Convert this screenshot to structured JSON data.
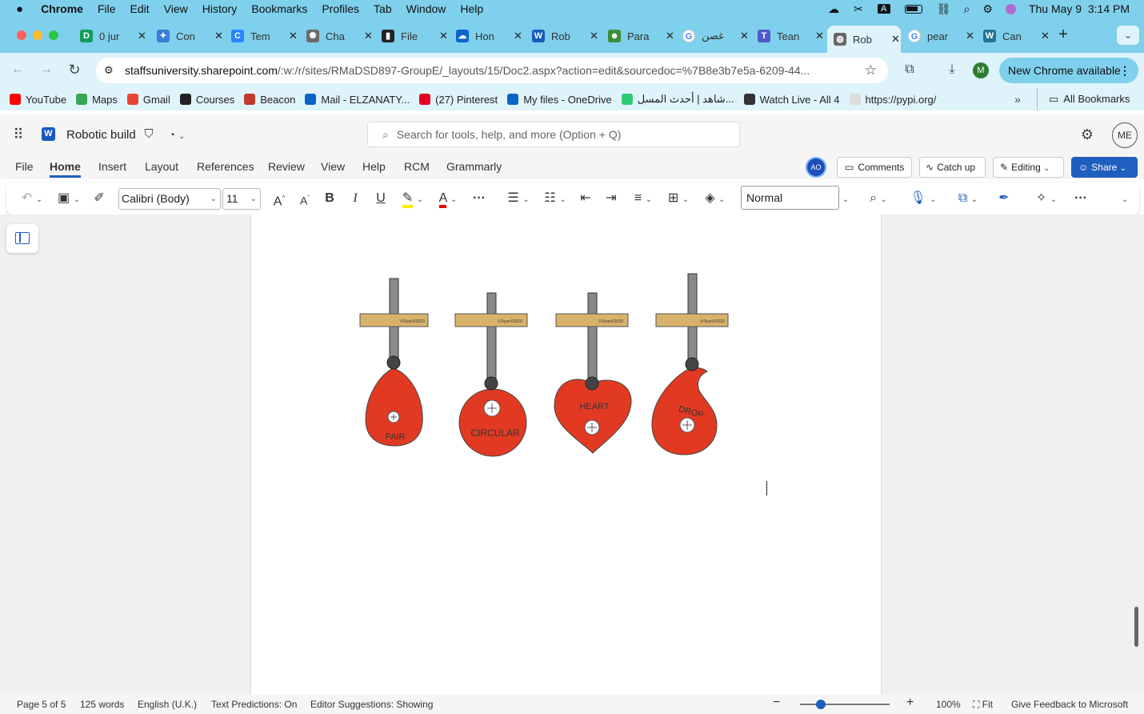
{
  "menubar": {
    "app": "Chrome",
    "items": [
      "File",
      "Edit",
      "View",
      "History",
      "Bookmarks",
      "Profiles",
      "Tab",
      "Window",
      "Help"
    ],
    "input_badge": "A",
    "clock": "Thu May 9  3:14 PM"
  },
  "tabs": [
    {
      "title": "0 jur",
      "color": "#0f9d58",
      "glyph": "D"
    },
    {
      "title": "Con",
      "color": "#3a7bd5",
      "glyph": "✦"
    },
    {
      "title": "Tem",
      "color": "#2684ff",
      "glyph": "C"
    },
    {
      "title": "Cha",
      "color": "#6b6b6b",
      "glyph": "✺"
    },
    {
      "title": "File",
      "color": "#222222",
      "glyph": "▮"
    },
    {
      "title": "Hon",
      "color": "#0a64c8",
      "glyph": "☁"
    },
    {
      "title": "Rob",
      "color": "#185abd",
      "glyph": "W"
    },
    {
      "title": "Para",
      "color": "#3c8c3c",
      "glyph": "☻"
    },
    {
      "title": "غصن",
      "color": "#ffffff",
      "glyph": "G"
    },
    {
      "title": "Tean",
      "color": "#5059c9",
      "glyph": "T"
    },
    {
      "title": "Rob",
      "color": "#666666",
      "glyph": "◍"
    },
    {
      "title": "pear",
      "color": "#ffffff",
      "glyph": "G"
    },
    {
      "title": "Can",
      "color": "#21759b",
      "glyph": "W"
    }
  ],
  "omnibox": {
    "host": "staffsuniversity.sharepoint.com",
    "path": "/:w:/r/sites/RMaDSD897-GroupE/_layouts/15/Doc2.aspx?action=edit&sourcedoc=%7B8e3b7e5a-6209-44...",
    "profile_initial": "M",
    "update_label": "New Chrome available"
  },
  "bookmarks": [
    {
      "label": "YouTube",
      "color": "#ff0000"
    },
    {
      "label": "Maps",
      "color": "#34a853"
    },
    {
      "label": "Gmail",
      "color": "#ea4335"
    },
    {
      "label": "Courses",
      "color": "#222222"
    },
    {
      "label": "Beacon",
      "color": "#c0392b"
    },
    {
      "label": "Mail - ELZANATY...",
      "color": "#0a64c8"
    },
    {
      "label": "(27) Pinterest",
      "color": "#e60023"
    },
    {
      "label": "My files - OneDrive",
      "color": "#0a64c8"
    },
    {
      "label": "شاهد | أحدث المسل...",
      "color": "#2ecc71"
    },
    {
      "label": "Watch Live - All 4",
      "color": "#333333"
    },
    {
      "label": "https://pypi.org/",
      "color": "#dddddd"
    }
  ],
  "all_bookmarks": "All Bookmarks",
  "word": {
    "doc_title": "Robotic build",
    "search_placeholder": "Search for tools, help, and more (Option + Q)",
    "user_initials": "ME",
    "coauthor_initials": "AO",
    "tabs": [
      "File",
      "Home",
      "Insert",
      "Layout",
      "References",
      "Review",
      "View",
      "Help",
      "RCM",
      "Grammarly"
    ],
    "active_tab": "Home",
    "comments_label": "Comments",
    "catchup_label": "Catch up",
    "editing_label": "Editing",
    "share_label": "Share",
    "font_name": "Calibri (Body)",
    "font_size": "11",
    "style_name": "Normal"
  },
  "figure": {
    "cams": [
      {
        "label": "PAIR"
      },
      {
        "label": "CIRCULAR"
      },
      {
        "label": "HEART"
      },
      {
        "label": "DROP"
      }
    ],
    "guide_text": "V.Ryan©2020",
    "cam_color": "#e23a22",
    "guide_color": "#d8b26a",
    "follower_color": "#8a8a8a"
  },
  "status": {
    "page": "Page 5 of 5",
    "words": "125 words",
    "language": "English (U.K.)",
    "predictions": "Text Predictions: On",
    "editor": "Editor Suggestions: Showing",
    "zoom": "100%",
    "fit": "Fit",
    "feedback": "Give Feedback to Microsoft"
  }
}
